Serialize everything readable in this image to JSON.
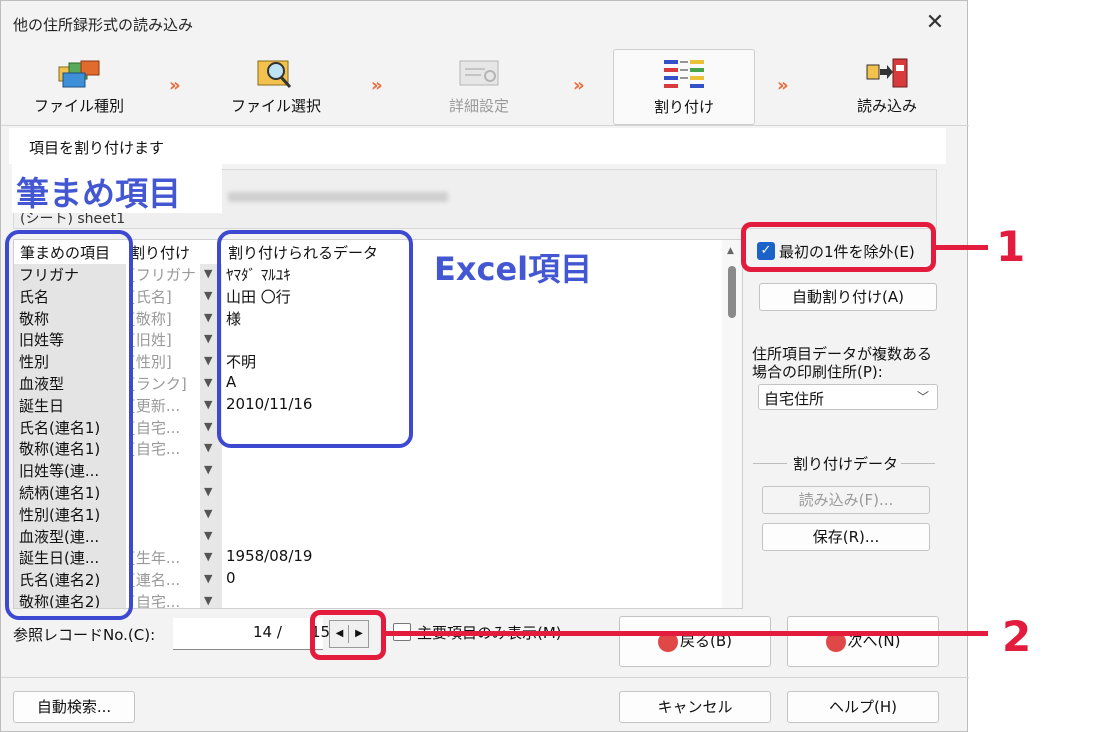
{
  "window": {
    "title": "他の住所録形式の読み込み"
  },
  "steps": [
    {
      "label": "ファイル種別",
      "icon": "folders-icon",
      "state": "done"
    },
    {
      "label": "ファイル選択",
      "icon": "folder-search-icon",
      "state": "done"
    },
    {
      "label": "詳細設定",
      "icon": "settings-sheet-icon",
      "state": "disabled"
    },
    {
      "label": "割り付け",
      "icon": "mapping-lines-icon",
      "state": "active"
    },
    {
      "label": "読み込み",
      "icon": "import-book-icon",
      "state": "pending"
    }
  ],
  "section_title": "項目を割り付けます",
  "file_box": {
    "sheet_label": "(シート) sheet1"
  },
  "annotations": {
    "hitsume_label": "筆まめ項目",
    "excel_label": "Excel項目",
    "num1": "1",
    "num2": "2"
  },
  "grid": {
    "headers": {
      "field": "筆まめの項目",
      "assign": "割り付け",
      "data": "割り付けられるデータ"
    },
    "rows": [
      {
        "field": "フリガナ",
        "assign": "[フリガナ]",
        "data": "ﾔﾏﾀﾞ ﾏﾙﾕｷ"
      },
      {
        "field": "氏名",
        "assign": "[氏名]",
        "data": "山田 〇行"
      },
      {
        "field": "敬称",
        "assign": "[敬称]",
        "data": "様"
      },
      {
        "field": "旧姓等",
        "assign": "[旧姓]",
        "data": ""
      },
      {
        "field": "性別",
        "assign": "[性別]",
        "data": "不明"
      },
      {
        "field": "血液型",
        "assign": "[ランク]",
        "data": "A"
      },
      {
        "field": "誕生日",
        "assign": "[更新...",
        "data": "2010/11/16"
      },
      {
        "field": "氏名(連名1)",
        "assign": "[自宅...",
        "data": ""
      },
      {
        "field": "敬称(連名1)",
        "assign": "[自宅...",
        "data": ""
      },
      {
        "field": "旧姓等(連...",
        "assign": "",
        "data": ""
      },
      {
        "field": "続柄(連名1)",
        "assign": "",
        "data": ""
      },
      {
        "field": "性別(連名1)",
        "assign": "",
        "data": ""
      },
      {
        "field": "血液型(連...",
        "assign": "",
        "data": ""
      },
      {
        "field": "誕生日(連...",
        "assign": "[生年...",
        "data": "1958/08/19"
      },
      {
        "field": "氏名(連名2)",
        "assign": "[連名...",
        "data": "0"
      },
      {
        "field": "敬称(連名2)",
        "assign": "[自宅...",
        "data": ""
      }
    ]
  },
  "right_panel": {
    "exclude_first_label": "最初の1件を除外(E)",
    "exclude_first_checked": true,
    "auto_assign_label": "自動割り付け(A)",
    "multi_address_label": "住所項目データが複数ある場合の印刷住所(P):",
    "address_select_value": "自宅住所",
    "assign_data_group": "割り付けデータ",
    "load_label": "読み込み(F)...",
    "save_label": "保存(R)..."
  },
  "record": {
    "label": "参照レコードNo.(C):",
    "value": "14 /",
    "total": "15",
    "main_only_label": "主要項目のみ表示(M)"
  },
  "nav": {
    "back_label": "戻る(B)",
    "next_label": "次へ(N)"
  },
  "footer": {
    "auto_search_label": "自動検索...",
    "cancel_label": "キャンセル",
    "help_label": "ヘルプ(H)"
  },
  "colors": {
    "annotation_red": "#e31c3d",
    "annotation_blue": "#3e49d1",
    "step_arrow": "#ef6a3b",
    "checkbox_blue": "#1b63c8"
  }
}
